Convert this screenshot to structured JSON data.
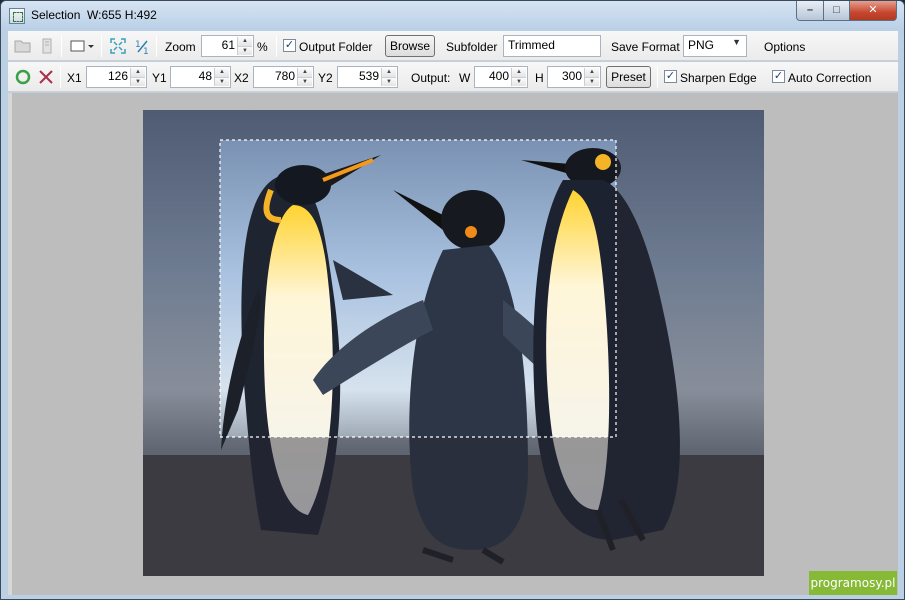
{
  "window": {
    "title": "Selection",
    "size_readout": "W:655 H:492",
    "minimize": "–",
    "maximize": "□",
    "close": "✕"
  },
  "toolbar1": {
    "zoom_label": "Zoom",
    "zoom_value": "61",
    "zoom_unit": "%",
    "output_folder_label": "Output Folder",
    "output_folder_checked": true,
    "browse_label": "Browse",
    "subfolder_label": "Subfolder",
    "subfolder_value": "Trimmed",
    "save_format_label": "Save Format",
    "save_format_value": "PNG",
    "options_label": "Options"
  },
  "toolbar2": {
    "x1_label": "X1",
    "x1_value": "126",
    "y1_label": "Y1",
    "y1_value": "48",
    "x2_label": "X2",
    "x2_value": "780",
    "y2_label": "Y2",
    "y2_value": "539",
    "output_label": "Output:",
    "w_label": "W",
    "w_value": "400",
    "h_label": "H",
    "h_value": "300",
    "preset_label": "Preset",
    "sharpen_edge_label": "Sharpen Edge",
    "sharpen_edge_checked": true,
    "auto_correction_label": "Auto Correction",
    "auto_correction_checked": true
  },
  "icons": {
    "open": "folder-open-icon",
    "delete": "trash-icon",
    "selection_shape": "rectangle-select-icon",
    "fit": "fit-to-window-icon",
    "actual_size": "actual-size-icon",
    "apply": "circle-ok-icon",
    "cancel": "x-cancel-icon"
  },
  "colors": {
    "accent_green": "#86b935",
    "selection_border": "#ffffff"
  },
  "watermark": "programosy.pl"
}
